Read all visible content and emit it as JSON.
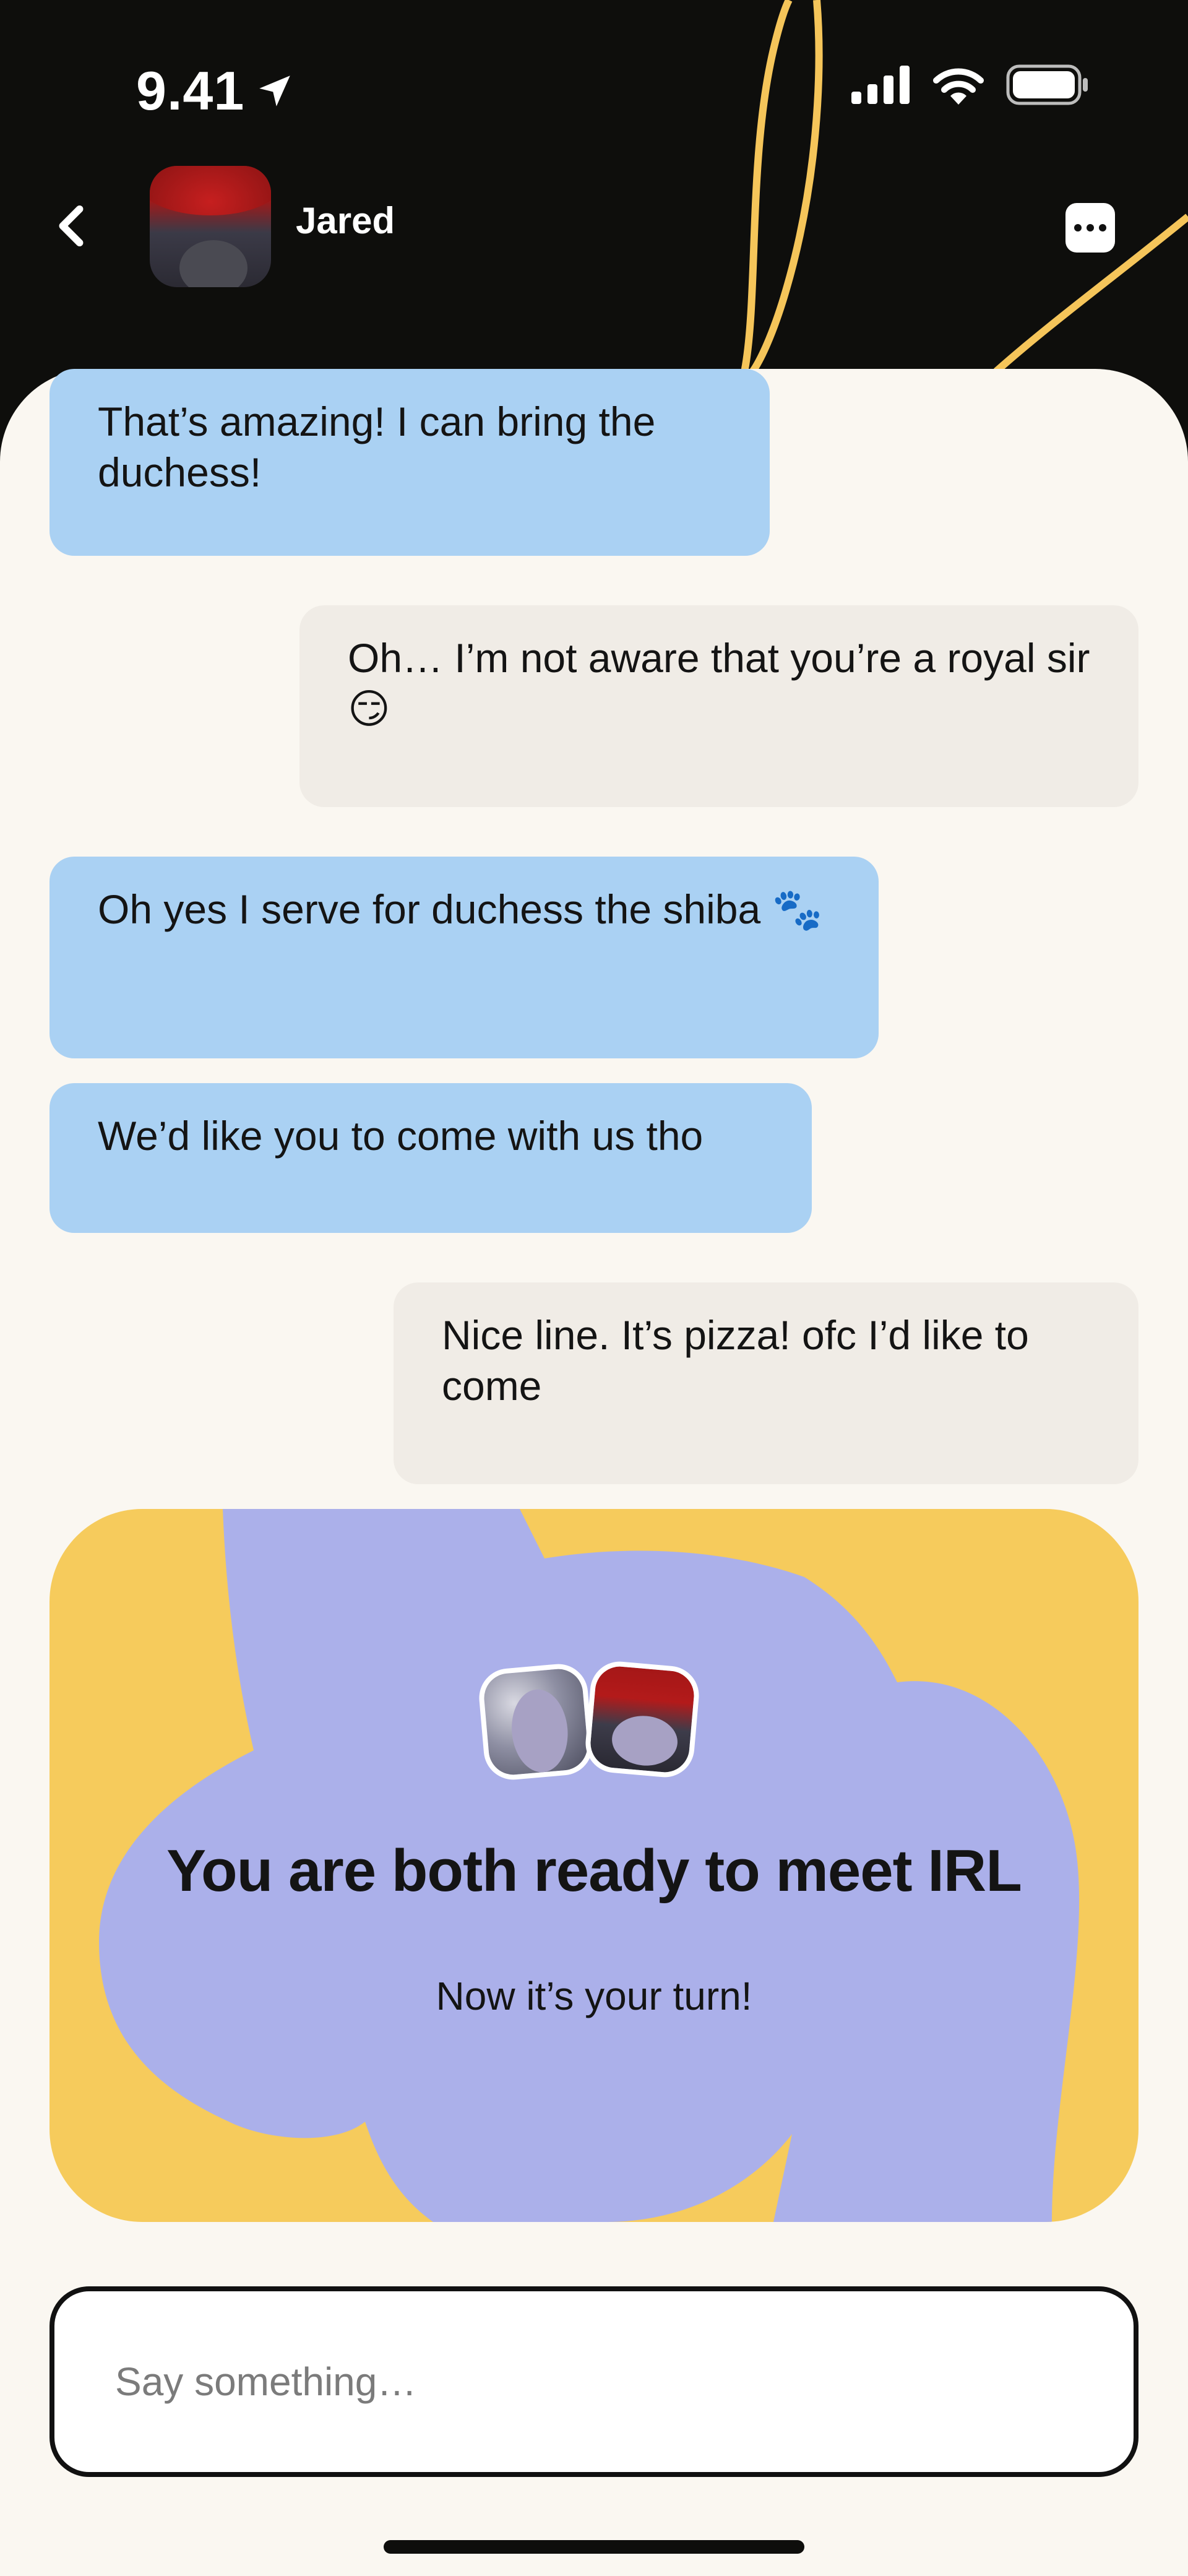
{
  "status_bar": {
    "time": "9.41"
  },
  "header": {
    "contact_name": "Jared",
    "back_icon": "chevron-left-icon",
    "more_icon": "more-dots-icon"
  },
  "messages": [
    {
      "direction": "incoming",
      "text": "That’s amazing! I can bring the duchess!"
    },
    {
      "direction": "outgoing",
      "text": "Oh… I’m not aware that you’re a royal sir 😏"
    },
    {
      "direction": "incoming",
      "text": "Oh yes I serve for duchess the shiba 🐾"
    },
    {
      "direction": "incoming",
      "text": "We’d like you to come with us tho"
    },
    {
      "direction": "outgoing",
      "text": "Nice line. It’s pizza! ofc I’d like to come"
    }
  ],
  "meet_card": {
    "title": "You are both ready to meet IRL",
    "subtitle": "Now it’s your turn!"
  },
  "composer": {
    "placeholder": "Say something…"
  },
  "colors": {
    "header_bg": "#0E0E0C",
    "deco_line": "#F5C55A",
    "incoming_bubble": "#AAD1F3",
    "outgoing_bubble": "#F0ECE6",
    "card_bg": "#F6CB5C",
    "card_cloud": "#ABB0EA",
    "surface": "#FAF7F1"
  }
}
